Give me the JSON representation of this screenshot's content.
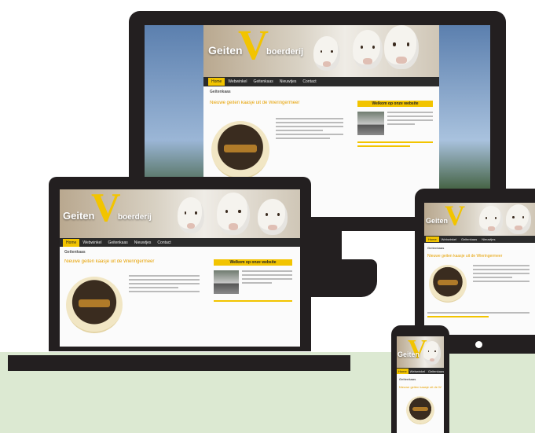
{
  "logo": {
    "brand_left": "Geiten",
    "brand_right": "boerderij",
    "mark": "V"
  },
  "nav": {
    "items": [
      "Home",
      "Webwinkel",
      "Geitenkaas",
      "Nieuwtjes",
      "Contact"
    ]
  },
  "page": {
    "breadcrumb": "Geitenkaas",
    "article_title": "Nieuwe geiten kaasje uit de Wieringermeer"
  },
  "sidebar": {
    "heading": "Welkom op onze website"
  },
  "colors": {
    "accent": "#f2c400",
    "device": "#231f20",
    "nav": "#2b2b2b",
    "background_band": "#dce9d2"
  }
}
